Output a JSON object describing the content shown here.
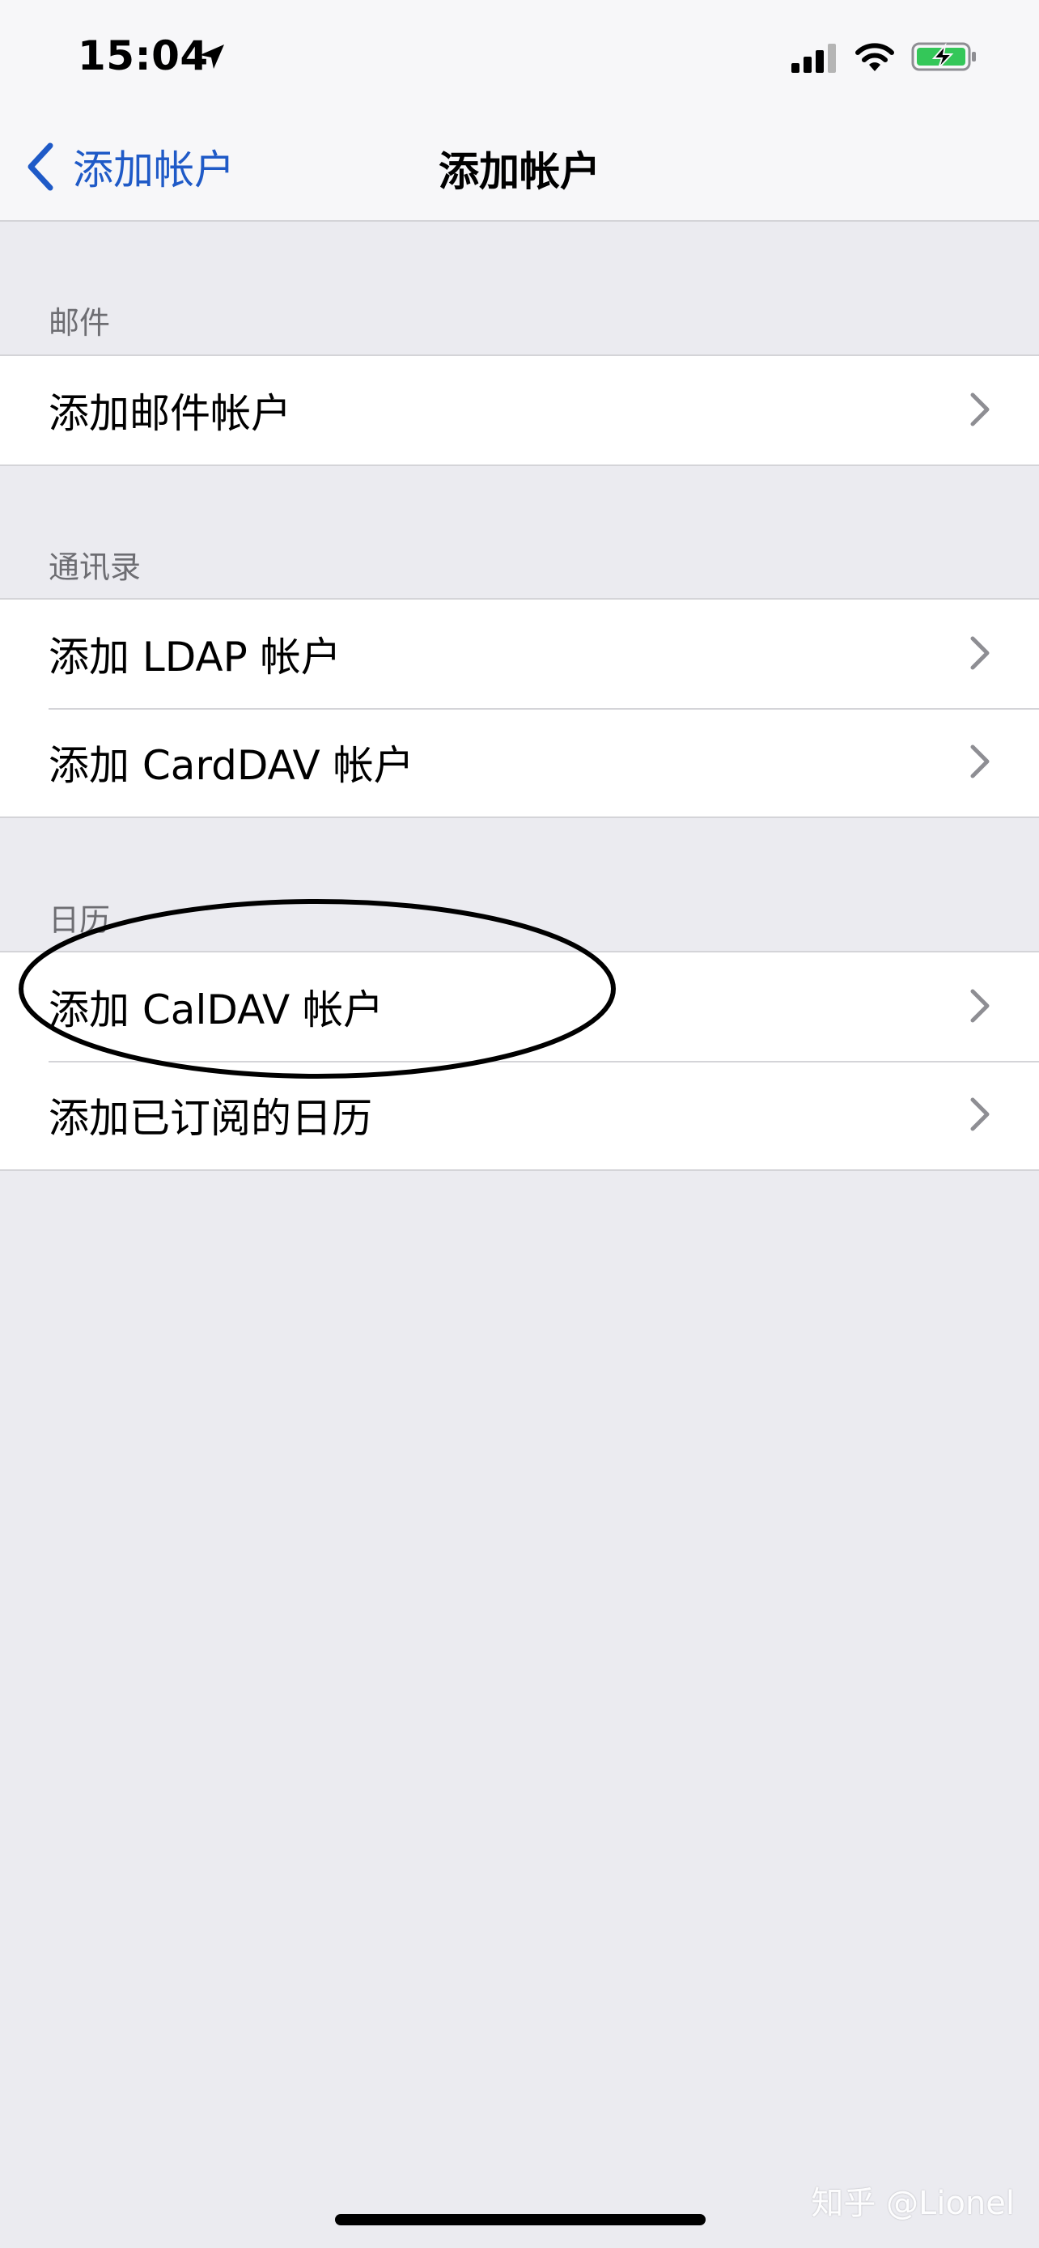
{
  "status_bar": {
    "time": "15:04"
  },
  "nav": {
    "back_label": "添加帐户",
    "title": "添加帐户"
  },
  "sections": [
    {
      "header": "邮件",
      "rows": [
        "添加邮件帐户"
      ]
    },
    {
      "header": "通讯录",
      "rows": [
        "添加 LDAP 帐户",
        "添加 CardDAV 帐户"
      ]
    },
    {
      "header": "日历",
      "rows": [
        "添加 CalDAV 帐户",
        "添加已订阅的日历"
      ]
    }
  ],
  "watermark": "知乎 @Lionel",
  "colors": {
    "accent": "#1f5ac7",
    "battery": "#34c759",
    "background": "#ebebf0"
  }
}
